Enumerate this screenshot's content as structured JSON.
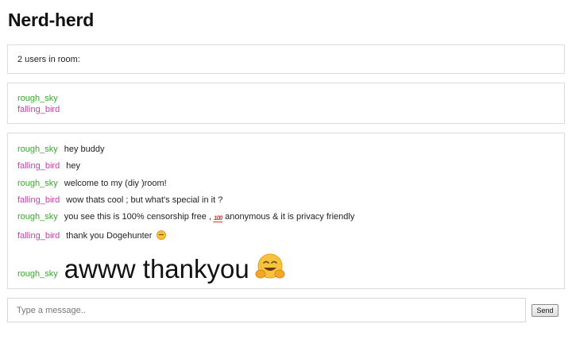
{
  "room": {
    "title": "Nerd-herd",
    "user_count_text": "2 users in room:"
  },
  "users": [
    {
      "name": "rough_sky",
      "color": "#3aa630"
    },
    {
      "name": "falling_bird",
      "color": "#d13aa8"
    }
  ],
  "messages": [
    {
      "user": "rough_sky",
      "text": "hey buddy"
    },
    {
      "user": "falling_bird",
      "text": "hey"
    },
    {
      "user": "rough_sky",
      "text": "welcome to my (diy )room!"
    },
    {
      "user": "falling_bird",
      "text": "wow thats cool ; but what's special in it ?"
    },
    {
      "user": "rough_sky",
      "text_before": "you see this is 100% censorship free ,",
      "emoji": "hundred-points-emoji",
      "emoji_text": "100",
      "text_after": "anonymous & it is privacy friendly"
    },
    {
      "user": "falling_bird",
      "text": "thank you Dogehunter",
      "emoji": "relieved-face-emoji"
    },
    {
      "user": "rough_sky",
      "text": "awww thankyou",
      "emoji": "hugging-face-emoji"
    }
  ],
  "composer": {
    "placeholder": "Type a message..",
    "value": "",
    "send_label": "Send"
  },
  "colors": {
    "user_green": "#3aa630",
    "user_pink": "#d13aa8",
    "panel_border": "#dcdcdc"
  }
}
